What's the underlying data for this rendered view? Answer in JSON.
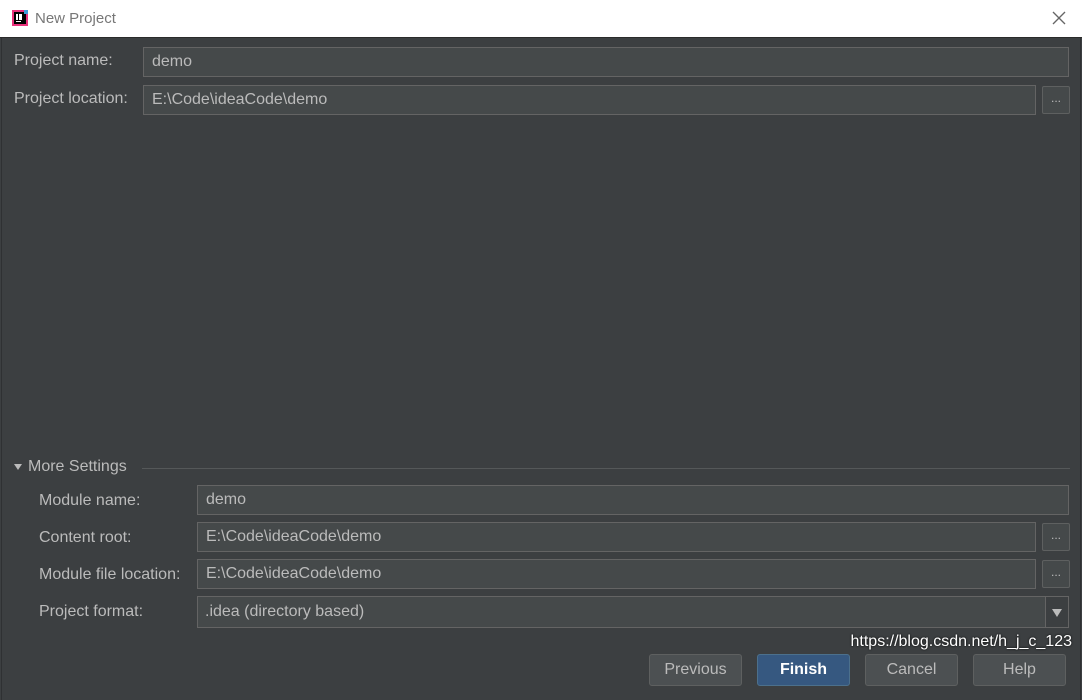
{
  "window": {
    "title": "New Project",
    "icon": "intellij-idea-icon",
    "close_icon": "close-icon"
  },
  "form": {
    "project_name_label": "Project name:",
    "project_name_value": "demo",
    "project_location_label": "Project location:",
    "project_location_value": "E:\\Code\\ideaCode\\demo",
    "browse_label": "..."
  },
  "more_settings": {
    "header": "More Settings",
    "module_name_label": "Module name:",
    "module_name_value": "demo",
    "content_root_label": "Content root:",
    "content_root_value": "E:\\Code\\ideaCode\\demo",
    "module_file_location_label": "Module file location:",
    "module_file_location_value": "E:\\Code\\ideaCode\\demo",
    "project_format_label": "Project format:",
    "project_format_value": ".idea (directory based)"
  },
  "buttons": {
    "previous": "Previous",
    "finish": "Finish",
    "cancel": "Cancel",
    "help": "Help"
  },
  "watermark": "https://blog.csdn.net/h_j_c_123",
  "colors": {
    "background": "#3c3f41",
    "field": "#45494a",
    "primary_button": "#365880"
  }
}
